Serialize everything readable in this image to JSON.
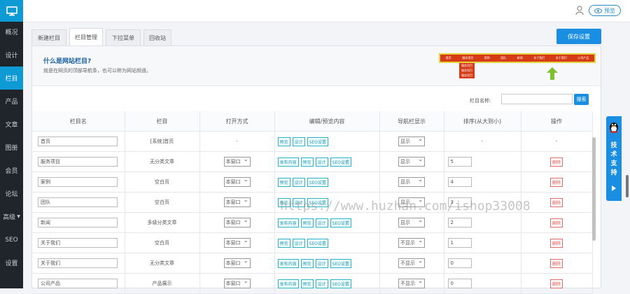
{
  "sidebar": {
    "items": [
      {
        "label": "概况",
        "active": false
      },
      {
        "label": "设计",
        "active": false
      },
      {
        "label": "栏目",
        "active": true
      },
      {
        "label": "产品",
        "active": false
      },
      {
        "label": "文章",
        "active": false
      },
      {
        "label": "图册",
        "active": false
      },
      {
        "label": "会员",
        "active": false
      },
      {
        "label": "论坛",
        "active": false
      },
      {
        "label": "高级",
        "active": false
      },
      {
        "label": "SEO",
        "active": false
      },
      {
        "label": "设置",
        "active": false
      }
    ]
  },
  "topbar": {
    "preview_label": "预览"
  },
  "tabs": [
    {
      "label": "新建栏目",
      "active": false
    },
    {
      "label": "栏目管理",
      "active": true
    },
    {
      "label": "下拉菜单",
      "active": false
    },
    {
      "label": "回收站",
      "active": false
    }
  ],
  "save_label": "保存设置",
  "info": {
    "title": "什么是网站栏目?",
    "desc": "就是在网页的顶部导航条，也可以称为网站频道。",
    "demo_items": [
      "首页",
      "服务项目",
      "案例",
      "团队",
      "新闻",
      "关于我们",
      "关于我们",
      "公司产品"
    ],
    "demo_dropdown": [
      "服务项目",
      "服务项目",
      "服务项目"
    ]
  },
  "filter": {
    "label": "栏目名称:",
    "button": "搜索"
  },
  "table": {
    "headers": [
      "栏目名",
      "栏目",
      "打开方式",
      "编辑/预览内容",
      "导航栏显示",
      "排序(从大到小)",
      "操作"
    ],
    "rows": [
      {
        "name": "首页",
        "type": "[系统]首页",
        "open": "-",
        "buttons": [
          "预览",
          "设计",
          "SEO设置"
        ],
        "nav": "显示",
        "sort": "-",
        "op": "-"
      },
      {
        "name": "服务项目",
        "type": "无分类文章",
        "open": "本窗口",
        "buttons": [
          "发布内容",
          "预览",
          "设计",
          "SEO设置"
        ],
        "nav": "显示",
        "sort": "5",
        "op": "删除"
      },
      {
        "name": "案例",
        "type": "空白页",
        "open": "本窗口",
        "buttons": [
          "预览",
          "设计",
          "SEO设置"
        ],
        "nav": "显示",
        "sort": "4",
        "op": "删除"
      },
      {
        "name": "团队",
        "type": "空白页",
        "open": "本窗口",
        "buttons": [
          "预览",
          "设计",
          "SEO设置"
        ],
        "nav": "显示",
        "sort": "3",
        "op": "删除"
      },
      {
        "name": "新闻",
        "type": "多级分类文章",
        "open": "本窗口",
        "buttons": [
          "发布内容",
          "预览",
          "设计",
          "SEO设置"
        ],
        "nav": "显示",
        "sort": "2",
        "op": "删除"
      },
      {
        "name": "关于我们",
        "type": "空白页",
        "open": "本窗口",
        "buttons": [
          "预览",
          "设计",
          "SEO设置"
        ],
        "nav": "不显示",
        "sort": "1",
        "op": "删除"
      },
      {
        "name": "关于我们",
        "type": "无分类文章",
        "open": "本窗口",
        "buttons": [
          "发布内容",
          "预览",
          "设计",
          "SEO设置"
        ],
        "nav": "不显示",
        "sort": "0",
        "op": "删除"
      },
      {
        "name": "公司产品",
        "type": "产品展示",
        "open": "本窗口",
        "buttons": [
          "发布内容",
          "预览",
          "设计",
          "SEO设置"
        ],
        "nav": "不显示",
        "sort": "0",
        "op": "删除"
      }
    ]
  },
  "side_widget": {
    "label": "技术支持"
  },
  "watermark": "https://www.huzhan.com/ishop33008",
  "colors": {
    "accent": "#1a8ee0",
    "sidebar_bg": "#1f252b",
    "active_nav": "#0e9ad5",
    "tag": "#25b4c9",
    "delete": "#d9534f"
  }
}
